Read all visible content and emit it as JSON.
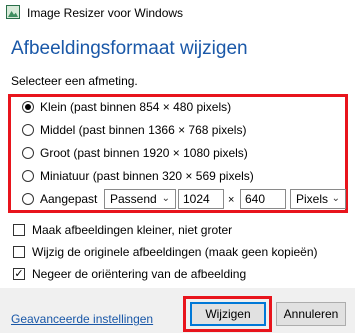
{
  "window": {
    "title": "Image Resizer voor Windows",
    "icon": "image-icon"
  },
  "heading": "Afbeeldingsformaat wijzigen",
  "prompt": "Selecteer een afmeting.",
  "sizes": [
    {
      "label": "Klein (past binnen 854 × 480 pixels)",
      "checked": true
    },
    {
      "label": "Middel (past binnen 1366 × 768 pixels)",
      "checked": false
    },
    {
      "label": "Groot (past binnen 1920 × 1080 pixels)",
      "checked": false
    },
    {
      "label": "Miniatuur (past binnen 320 × 569 pixels)",
      "checked": false
    }
  ],
  "custom": {
    "label": "Aangepast",
    "fit_value": "Passend",
    "width": "1024",
    "times": "×",
    "height": "640",
    "unit_value": "Pixels"
  },
  "options": [
    {
      "label": "Maak afbeeldingen kleiner, niet groter",
      "checked": false
    },
    {
      "label": "Wijzig de originele afbeeldingen (maak geen kopieën)",
      "checked": false
    },
    {
      "label": "Negeer de oriëntering van de afbeelding",
      "checked": true
    }
  ],
  "footer": {
    "advanced_link": "Geavanceerde instellingen",
    "resize_button": "Wijzigen",
    "cancel_button": "Annuleren"
  },
  "colors": {
    "accent": "#1a58a8",
    "highlight": "#e8141c"
  }
}
